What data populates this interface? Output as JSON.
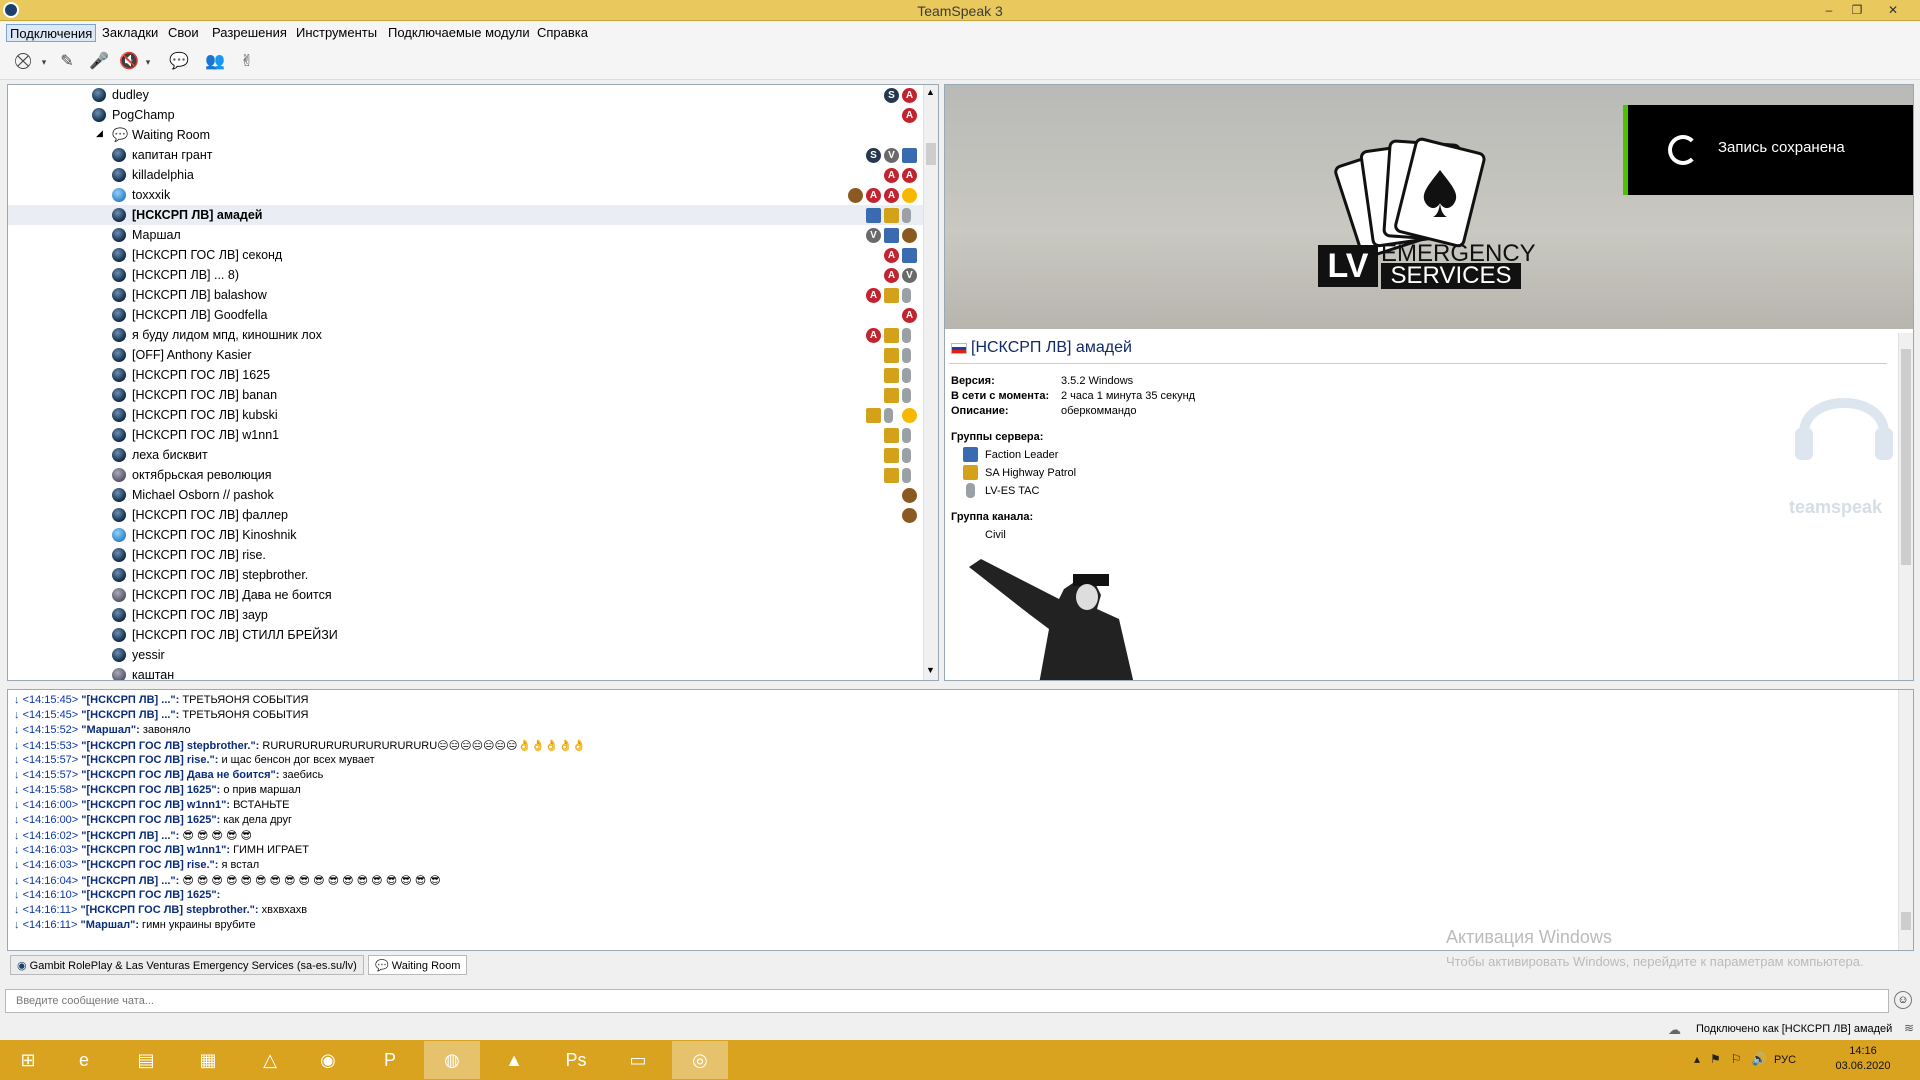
{
  "window": {
    "title": "TeamSpeak 3",
    "controls": {
      "min": "–",
      "max": "❐",
      "close": "✕"
    }
  },
  "menu": [
    "Подключения",
    "Закладки",
    "Свои",
    "Разрешения",
    "Инструменты",
    "Подключаемые модули",
    "Справка"
  ],
  "toolbar": {
    "icons": [
      "connect-icon",
      "disconnect-icon",
      "mute-mic-icon",
      "mute-speakers-icon",
      "away-icon",
      "contacts-icon",
      "whisper-icon"
    ]
  },
  "tree": {
    "rows": [
      {
        "name": "dudley",
        "indent": 1,
        "badges": [
          "S",
          "A"
        ],
        "ball": "dark"
      },
      {
        "name": "PogChamp",
        "indent": 1,
        "badges": [
          "A"
        ],
        "ball": "dark"
      },
      {
        "name": "Waiting Room",
        "indent": 0,
        "channel": true,
        "badges": []
      },
      {
        "name": "капитан грант",
        "indent": 2,
        "badges": [
          "S",
          "V",
          "F"
        ],
        "ball": "dark"
      },
      {
        "name": "killadelphia",
        "indent": 2,
        "badges": [
          "A",
          "A"
        ],
        "ball": "dark"
      },
      {
        "name": "toxxxik",
        "indent": 2,
        "badges": [
          "O",
          "A",
          "A",
          "W"
        ],
        "ball": "lt"
      },
      {
        "name": "[НСКСРП ЛВ] амадей",
        "indent": 2,
        "badges": [
          "F",
          "G",
          "T"
        ],
        "ball": "dark",
        "bold": true,
        "selected": true
      },
      {
        "name": "Маршал",
        "indent": 2,
        "badges": [
          "V",
          "F",
          "O"
        ],
        "ball": "dark"
      },
      {
        "name": "[НСКСРП ГОС ЛВ] секонд",
        "indent": 2,
        "badges": [
          "A",
          "F"
        ],
        "ball": "dark"
      },
      {
        "name": "[НСКСРП ЛВ] ... 8)",
        "indent": 2,
        "badges": [
          "A",
          "V"
        ],
        "ball": "dark"
      },
      {
        "name": "[НСКСРП ЛВ] balashow",
        "indent": 2,
        "badges": [
          "A",
          "G",
          "T"
        ],
        "ball": "dark"
      },
      {
        "name": "[НСКСРП ЛВ] Goodfella",
        "indent": 2,
        "badges": [
          "A"
        ],
        "ball": "dark"
      },
      {
        "name": "я буду лидом мпд, киношник лох",
        "indent": 2,
        "badges": [
          "A",
          "G",
          "T"
        ],
        "ball": "dark"
      },
      {
        "name": "[OFF] Anthony Kasier",
        "indent": 2,
        "badges": [
          "G",
          "T"
        ],
        "ball": "dark"
      },
      {
        "name": "[НСКСРП ГОС ЛВ] 1625",
        "indent": 2,
        "badges": [
          "G",
          "T"
        ],
        "ball": "dark"
      },
      {
        "name": "[НСКСРП ГОС ЛВ] banan",
        "indent": 2,
        "badges": [
          "G",
          "T"
        ],
        "ball": "dark"
      },
      {
        "name": "[НСКСРП ГОС ЛВ] kubski",
        "indent": 2,
        "badges": [
          "G",
          "T",
          "W"
        ],
        "ball": "dark"
      },
      {
        "name": "[НСКСРП ГОС ЛВ] w1nn1",
        "indent": 2,
        "badges": [
          "G",
          "T"
        ],
        "ball": "dark"
      },
      {
        "name": "леха бисквит",
        "indent": 2,
        "badges": [
          "G",
          "T"
        ],
        "ball": "dark"
      },
      {
        "name": "октябрьская революция",
        "indent": 2,
        "badges": [
          "G",
          "T"
        ],
        "ball": "away"
      },
      {
        "name": "Michael Osborn // pashok",
        "indent": 2,
        "badges": [
          "O"
        ],
        "ball": "dark"
      },
      {
        "name": "[НСКСРП ГОС ЛВ] фаллер",
        "indent": 2,
        "badges": [
          "O"
        ],
        "ball": "dark"
      },
      {
        "name": "[НСКСРП ГОС ЛВ] Kinoshnik",
        "indent": 2,
        "badges": [],
        "ball": "lt"
      },
      {
        "name": "[НСКСРП ГОС ЛВ] rise.",
        "indent": 2,
        "badges": [],
        "ball": "dark"
      },
      {
        "name": "[НСКСРП ГОС ЛВ] stepbrother.",
        "indent": 2,
        "badges": [],
        "ball": "dark"
      },
      {
        "name": "[НСКСРП ГОС ЛВ] Дава не боится",
        "indent": 2,
        "badges": [],
        "ball": "away"
      },
      {
        "name": "[НСКСРП ГОС ЛВ] заур",
        "indent": 2,
        "badges": [],
        "ball": "dark"
      },
      {
        "name": "[НСКСРП ГОС ЛВ] СТИЛЛ БРЕЙЗИ",
        "indent": 2,
        "badges": [],
        "ball": "dark"
      },
      {
        "name": "yessir",
        "indent": 2,
        "badges": [],
        "ball": "dark"
      },
      {
        "name": "каштан",
        "indent": 2,
        "badges": [],
        "ball": "away"
      }
    ]
  },
  "banner": {
    "logo_big": "LV",
    "logo_line1": "EMERGENCY",
    "logo_line2": "SERVICES",
    "toast": "Запись сохранена"
  },
  "info": {
    "name": "[НСКСРП ЛВ] амадей",
    "fields": [
      {
        "label": "Версия:",
        "value": "3.5.2 Windows"
      },
      {
        "label": "В сети с момента:",
        "value": "2 часа 1 минута 35 секунд"
      },
      {
        "label": "Описание:",
        "value": "оберкоммандо"
      }
    ],
    "server_groups_label": "Группы сервера:",
    "server_groups": [
      "Faction Leader",
      "SA Highway Patrol",
      "LV-ES TAC"
    ],
    "channel_group_label": "Группа канала:",
    "channel_group": "Civil",
    "brand": "teamspeak"
  },
  "chat": {
    "lines": [
      {
        "time": "<14:15:45>",
        "nick": "\"[НСКСРП ЛВ] ...\":",
        "msg": " ТРЕТЬЯОНЯ СОБЫТИЯ"
      },
      {
        "time": "<14:15:45>",
        "nick": "\"[НСКСРП ЛВ] ...\":",
        "msg": " ТРЕТЬЯОНЯ СОБЫТИЯ"
      },
      {
        "time": "<14:15:52>",
        "nick": "\"Маршал\":",
        "msg": " завоняло"
      },
      {
        "time": "<14:15:53>",
        "nick": "\"[НСКСРП ГОС ЛВ] stepbrother.\":",
        "msg": " RURURURURURURURURURURU😑😑😑😑😑😑😑👌👌👌👌👌"
      },
      {
        "time": "<14:15:57>",
        "nick": "\"[НСКСРП ГОС ЛВ] rise.\":",
        "msg": " и щас бенсон дог всех мувает"
      },
      {
        "time": "<14:15:57>",
        "nick": "\"[НСКСРП ГОС ЛВ] Дава не боится\":",
        "msg": " заебись"
      },
      {
        "time": "<14:15:58>",
        "nick": "\"[НСКСРП ГОС ЛВ] 1625\":",
        "msg": " о прив маршал"
      },
      {
        "time": "<14:16:00>",
        "nick": "\"[НСКСРП ГОС ЛВ] w1nn1\":",
        "msg": " ВСТАНЬТЕ"
      },
      {
        "time": "<14:16:00>",
        "nick": "\"[НСКСРП ГОС ЛВ] 1625\":",
        "msg": " как дела друг"
      },
      {
        "time": "<14:16:02>",
        "nick": "\"[НСКСРП ЛВ] ...\":",
        "msg": " 😎 😎 😎 😎 😎"
      },
      {
        "time": "<14:16:03>",
        "nick": "\"[НСКСРП ГОС ЛВ] w1nn1\":",
        "msg": " ГИМН ИГРАЕТ"
      },
      {
        "time": "<14:16:03>",
        "nick": "\"[НСКСРП ГОС ЛВ] rise.\":",
        "msg": " я встал"
      },
      {
        "time": "<14:16:04>",
        "nick": "\"[НСКСРП ЛВ] ...\":",
        "msg": " 😎 😎 😎 😎 😎 😎 😎 😎 😎 😎 😎 😎 😎 😎 😎 😎 😎 😎"
      },
      {
        "time": "<14:16:10>",
        "nick": "\"[НСКСРП ГОС ЛВ] 1625\":",
        "msg": ""
      },
      {
        "time": "<14:16:11>",
        "nick": "\"[НСКСРП ГОС ЛВ] stepbrother.\":",
        "msg": " хвхвхахв"
      },
      {
        "time": "<14:16:11>",
        "nick": "\"Маршал\":",
        "msg": " гимн украины врубите"
      }
    ]
  },
  "tabs": [
    {
      "label": "Gambit RolePlay & Las Venturas Emergency Services (sa-es.su/lv)",
      "active": false
    },
    {
      "label": "Waiting Room",
      "active": true
    }
  ],
  "chat_input": {
    "placeholder": "Введите сообщение чата..."
  },
  "status": {
    "text": "Подключено как [НСКСРП ЛВ] амадей"
  },
  "activation": {
    "title": "Активация Windows",
    "text": "Чтобы активировать Windows, перейдите к параметрам компьютера."
  },
  "taskbar": {
    "apps": [
      "start-icon",
      "ie-icon",
      "explorer-icon",
      "store-icon",
      "avast-icon",
      "chrome-icon",
      "powerpoint-icon",
      "firefox-icon",
      "game-icon",
      "photoshop-icon",
      "app-icon",
      "teamspeak-icon"
    ],
    "lang": "РУС",
    "time": "14:16",
    "date": "03.06.2020"
  }
}
